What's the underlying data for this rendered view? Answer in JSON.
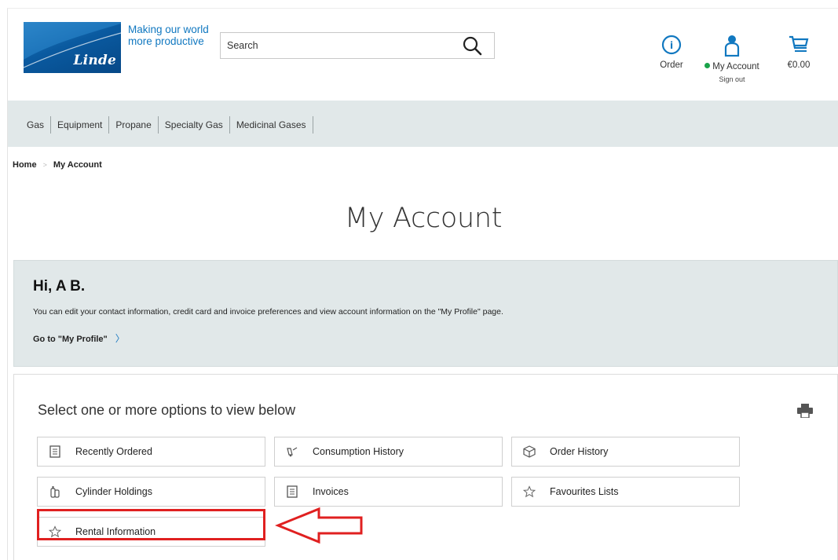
{
  "header": {
    "logo_text": "Linde",
    "tagline": "Making our world more productive",
    "search_placeholder": "Search",
    "order_label": "Order",
    "account_label": "My Account",
    "signout_label": "Sign out",
    "cart_total": "€0.00",
    "brand_color": "#1178c0"
  },
  "nav": {
    "items": [
      "Gas",
      "Equipment",
      "Propane",
      "Specialty Gas",
      "Medicinal Gases"
    ]
  },
  "breadcrumb": {
    "home": "Home",
    "separator": ">",
    "current": "My Account"
  },
  "page": {
    "title": "My Account"
  },
  "greeting": {
    "heading": "Hi, A B.",
    "text": "You can edit your contact information, credit card and invoice preferences and view account information on the \"My Profile\" page.",
    "link": "Go to \"My Profile\"",
    "link_chevron": "〉"
  },
  "options": {
    "title": "Select one or more options to view below",
    "items": [
      {
        "label": "Recently Ordered",
        "icon": "list-icon"
      },
      {
        "label": "Consumption History",
        "icon": "consumption-icon"
      },
      {
        "label": "Order History",
        "icon": "box-icon"
      },
      {
        "label": "Cylinder Holdings",
        "icon": "cylinder-icon"
      },
      {
        "label": "Invoices",
        "icon": "invoice-icon"
      },
      {
        "label": "Favourites Lists",
        "icon": "star-icon"
      },
      {
        "label": "Rental Information",
        "icon": "star-icon"
      }
    ],
    "highlight_color": "#e02020"
  }
}
